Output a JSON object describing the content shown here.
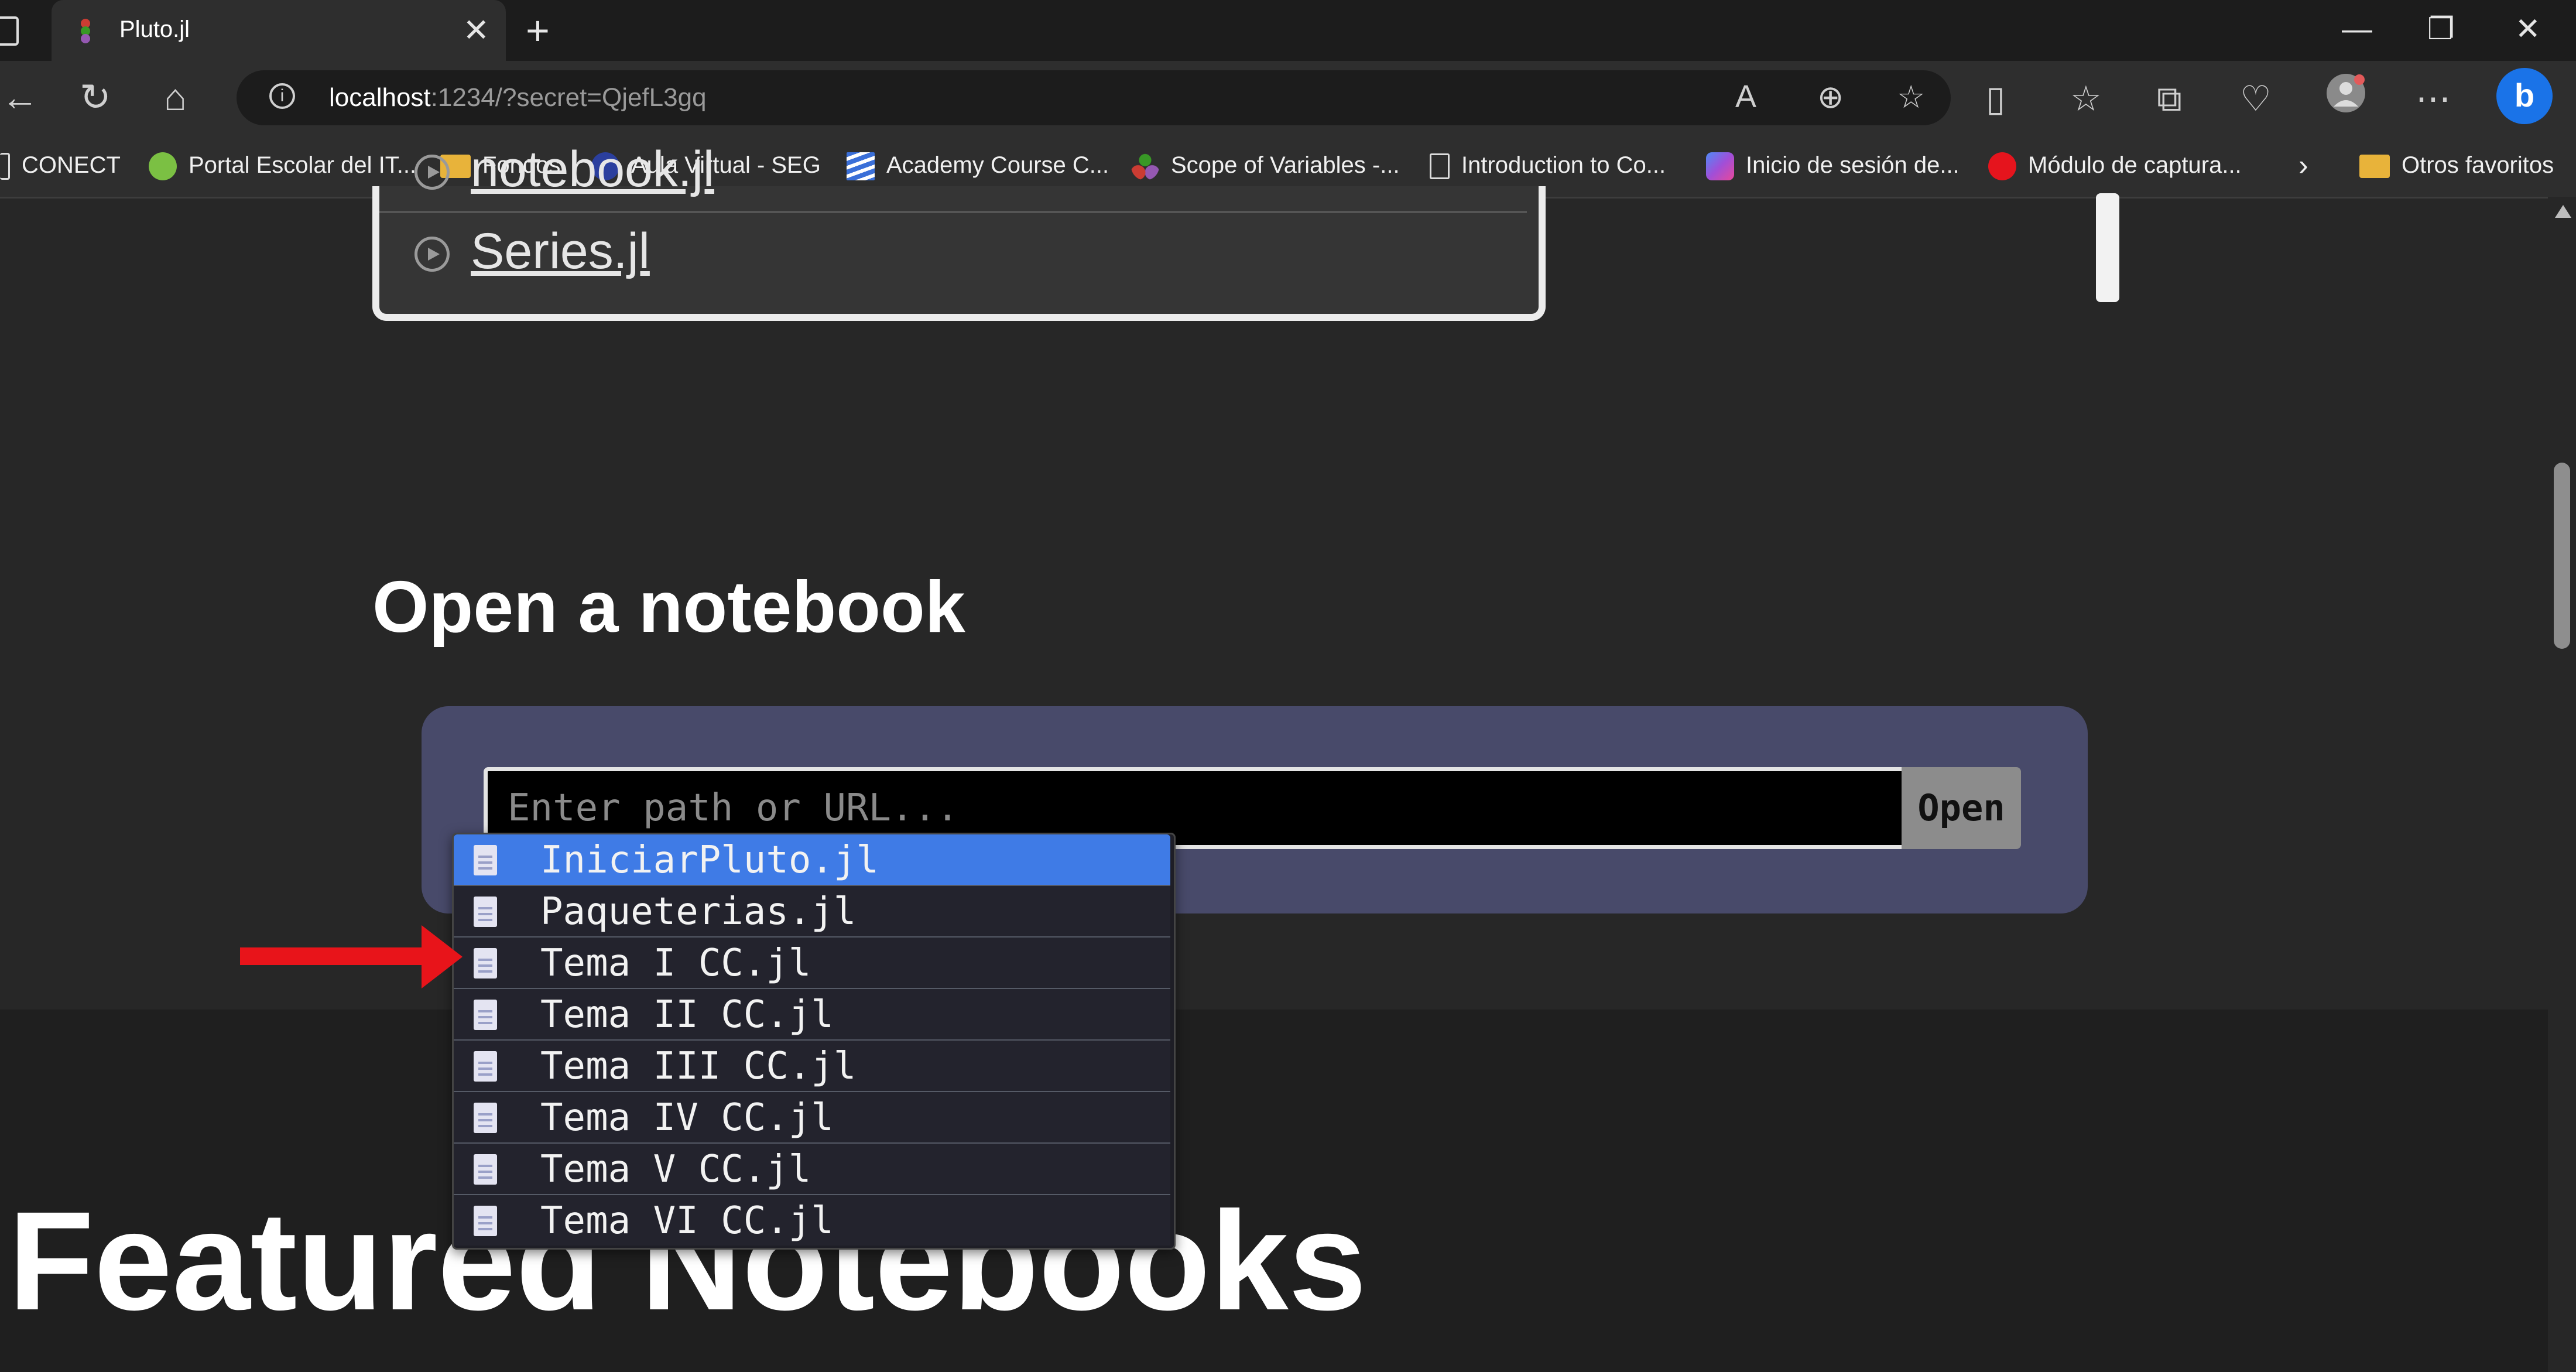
{
  "browser": {
    "tab_title": "Pluto.jl",
    "new_tab_symbol": "+",
    "close_symbol": "✕",
    "url_host": "localhost",
    "url_rest": ":1234/?secret=QjefL3gq",
    "window_controls": {
      "minimize": "—",
      "restore": "❐",
      "close": "✕"
    }
  },
  "bookmarks": [
    {
      "label": "CONECT",
      "icon": "page-icon"
    },
    {
      "label": "Portal Escolar del IT...",
      "icon": "green-leaf-icon"
    },
    {
      "label": "Fondos",
      "icon": "folder-icon"
    },
    {
      "label": "Aula Virtual - SEG",
      "icon": "seg-logo-icon"
    },
    {
      "label": "Academy Course C...",
      "icon": "academy-stripes-icon"
    },
    {
      "label": "Scope of Variables -...",
      "icon": "julia-dots-icon"
    },
    {
      "label": "Introduction to Co...",
      "icon": "page-icon"
    },
    {
      "label": "Inicio de sesión de...",
      "icon": "copilot-icon"
    },
    {
      "label": "Módulo de captura...",
      "icon": "red-circle-icon"
    },
    {
      "label": "Otros favoritos",
      "icon": "folder-icon"
    }
  ],
  "recent": {
    "items": [
      {
        "label": "notebook.jl"
      },
      {
        "label": "Series.jl"
      }
    ]
  },
  "open_section": {
    "title": "Open a notebook",
    "input_placeholder": "Enter path or URL...",
    "open_button": "Open"
  },
  "dropdown": {
    "items": [
      {
        "label": "IniciarPluto.jl",
        "selected": true
      },
      {
        "label": "Paqueterias.jl",
        "selected": false
      },
      {
        "label": "Tema I CC.jl",
        "selected": false
      },
      {
        "label": "Tema II CC.jl",
        "selected": false
      },
      {
        "label": "Tema III CC.jl",
        "selected": false
      },
      {
        "label": "Tema IV CC.jl",
        "selected": false
      },
      {
        "label": "Tema V CC.jl",
        "selected": false
      },
      {
        "label": "Tema VI CC.jl",
        "selected": false
      }
    ]
  },
  "featured": {
    "title": "Featured Notebooks"
  },
  "colors": {
    "selection": "#3f7be6",
    "panel": "#484a6a",
    "annotation_arrow": "#e8141a"
  }
}
